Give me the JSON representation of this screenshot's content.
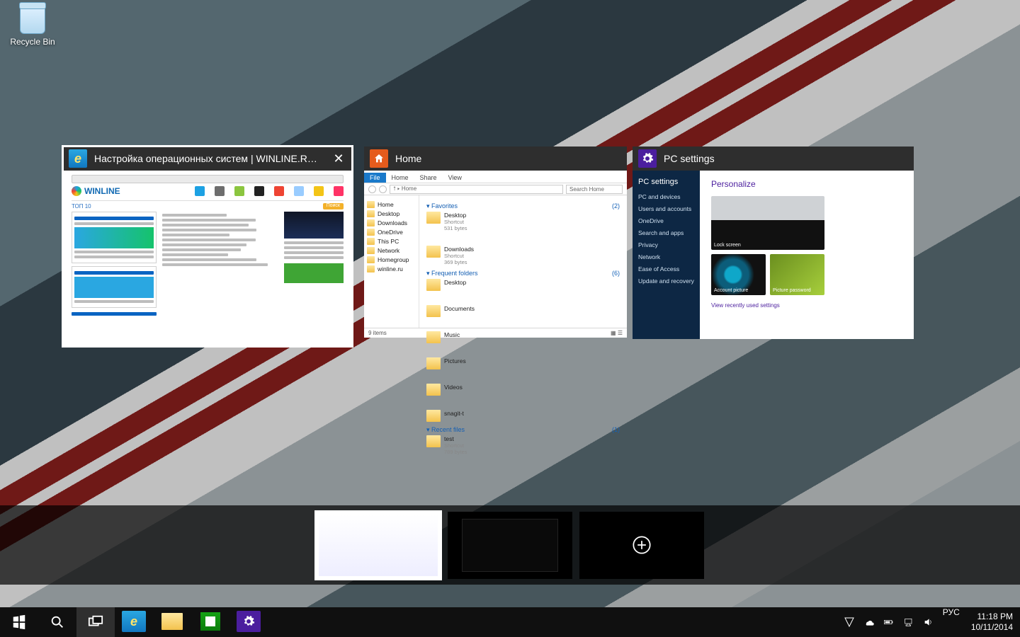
{
  "desktop": {
    "recycle_bin_label": "Recycle Bin"
  },
  "task_view": {
    "windows": [
      {
        "app": "Internet Explorer",
        "title": "Настройка операционных систем | WINLINE.RU ...",
        "selected": true,
        "page": {
          "site_logo_text": "WINLINE",
          "os_icons": [
            "Windows",
            "Mac OS X",
            "Android",
            "Linux",
            "iOS",
            "Chrome",
            "Firefox",
            "Phone OS"
          ],
          "top_label": "ТОП 10",
          "links_left": [
            "OS X Yosemite: как показать полный адрес страницы в Safari 8",
            "Удаление предварительных обновлений Windows 10",
            "Пять полезных способностей ноутбуков на Chrome OS"
          ],
          "links_mid": [
            "Выпущена версия iTunes 7.5 для Windows и Mac",
            "Microsoft начал новый MacBook Retina Setting",
            "Windows-фаза переустановки и Android Wear",
            "Microsoft анонсировала IE 12 и Windows 10",
            "McAfee выпустил бета-тестирование антивируса",
            "Microsoft представил новый ноутбук на Windows Phone",
            "Давид Microsoft выпустил Surface 5 и Surface Mini",
            "Windows 10: лучше чем Windows 8 всегда и везде",
            "Windows 10 получила апдейт Android",
            "МacBook Even 10 анонсирован обновл. версии",
            "Первая Microsoft сообщила VLC для Windows 8"
          ],
          "right_ads": [
            "Windows 10",
            "Android 5"
          ]
        }
      },
      {
        "app": "File Explorer",
        "title": "Home",
        "ribbon_tabs": [
          "File",
          "Home",
          "Share",
          "View"
        ],
        "breadcrumb": "⭡ ▸ Home",
        "search_placeholder": "Search Home",
        "tree": [
          "Home",
          "Desktop",
          "Downloads",
          "OneDrive",
          "This PC",
          "Network",
          "Homegroup",
          "winline.ru"
        ],
        "groups": [
          {
            "name": "Favorites",
            "count": "(2)",
            "items": [
              {
                "name": "Desktop",
                "sub": "Shortcut",
                "size": "531 bytes"
              },
              {
                "name": "Downloads",
                "sub": "Shortcut",
                "size": "369 bytes"
              }
            ]
          },
          {
            "name": "Frequent folders",
            "count": "(6)",
            "items": [
              {
                "name": "Desktop",
                "sub": ""
              },
              {
                "name": "Documents",
                "sub": ""
              },
              {
                "name": "Music",
                "sub": ""
              },
              {
                "name": "Pictures",
                "sub": ""
              },
              {
                "name": "Videos",
                "sub": ""
              },
              {
                "name": "snagit-t",
                "sub": ""
              }
            ]
          },
          {
            "name": "Recent files",
            "count": "(1)",
            "items": [
              {
                "name": "test",
                "sub": "Shortcut",
                "size": "789 bytes"
              }
            ]
          }
        ],
        "status": "9 items"
      },
      {
        "app": "PC settings",
        "title": "PC settings",
        "nav_heading": "PC settings",
        "nav_items": [
          "PC and devices",
          "Users and accounts",
          "OneDrive",
          "Search and apps",
          "Privacy",
          "Network",
          "Ease of Access",
          "Update and recovery"
        ],
        "section_heading": "Personalize",
        "tiles": [
          {
            "caption": "Lock screen"
          },
          {
            "caption": "Account picture"
          },
          {
            "caption": "Picture password"
          }
        ],
        "bottom_link": "View recently used settings"
      }
    ]
  },
  "virtual_desktops": {
    "desks": [
      {
        "selected": true
      },
      {
        "selected": false
      },
      {
        "selected": false,
        "is_add": true
      }
    ]
  },
  "taskbar": {
    "apps": [
      "Internet Explorer",
      "File Explorer",
      "Store",
      "Settings"
    ],
    "tray": [
      "action-center-icon",
      "onedrive-icon",
      "battery-icon",
      "network-icon",
      "volume-icon"
    ],
    "language": "РУС",
    "time": "11:18 PM",
    "date": "10/11/2014"
  }
}
